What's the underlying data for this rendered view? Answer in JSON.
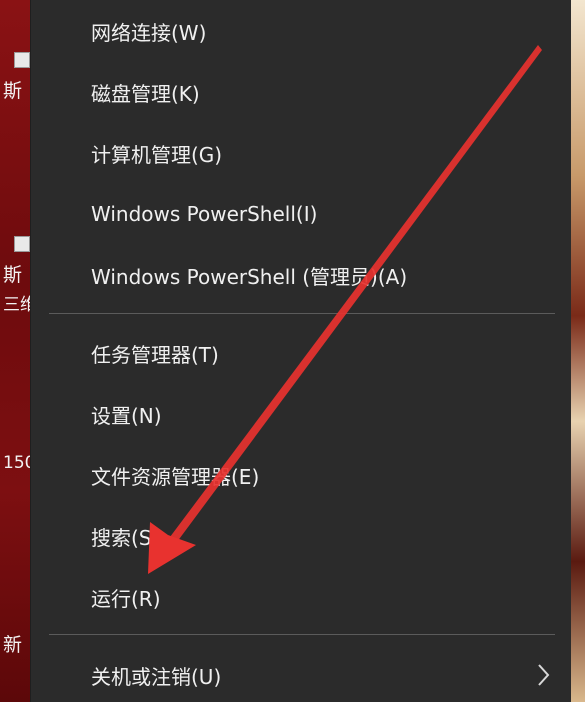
{
  "desktop": {
    "labels": [
      "斯",
      "斯",
      "三维",
      "150",
      "新"
    ]
  },
  "menu": {
    "items": [
      {
        "label": "网络连接(W)"
      },
      {
        "label": "磁盘管理(K)"
      },
      {
        "label": "计算机管理(G)"
      },
      {
        "label": "Windows PowerShell(I)"
      },
      {
        "label": "Windows PowerShell (管理员)(A)"
      },
      {
        "label": "任务管理器(T)"
      },
      {
        "label": "设置(N)"
      },
      {
        "label": "文件资源管理器(E)"
      },
      {
        "label": "搜索(S)"
      },
      {
        "label": "运行(R)"
      },
      {
        "label": "关机或注销(U)"
      }
    ],
    "submenu_icon": "chevron-right-icon"
  },
  "annotation": {
    "arrow_color": "#e8322f",
    "points_to": "运行(R)"
  }
}
